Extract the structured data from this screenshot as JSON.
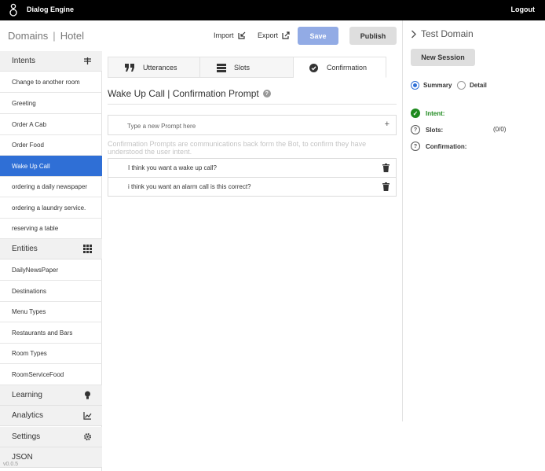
{
  "app": {
    "title": "Dialog Engine",
    "logout_label": "Logout",
    "version": "v0.0.5"
  },
  "breadcrumb": {
    "domains": "Domains",
    "separator": "|",
    "current": "Hotel"
  },
  "header": {
    "import_label": "Import",
    "export_label": "Export",
    "save_label": "Save",
    "publish_label": "Publish"
  },
  "sidebar": {
    "intents_label": "Intents",
    "intents": [
      {
        "label": "Change to another room"
      },
      {
        "label": "Greeting"
      },
      {
        "label": "Order A Cab"
      },
      {
        "label": "Order Food"
      },
      {
        "label": "Wake Up Call",
        "active": true
      },
      {
        "label": "ordering a daily newspaper"
      },
      {
        "label": "ordering a laundry service."
      },
      {
        "label": "reserving a table"
      }
    ],
    "entities_label": "Entities",
    "entities": [
      {
        "label": "DailyNewsPaper"
      },
      {
        "label": "Destinations"
      },
      {
        "label": "Menu Types"
      },
      {
        "label": "Restaurants and Bars"
      },
      {
        "label": "Room Types"
      },
      {
        "label": "RoomServiceFood"
      }
    ],
    "learning_label": "Learning",
    "analytics_label": "Analytics",
    "settings_label": "Settings",
    "json_label": "JSON"
  },
  "tabs": [
    {
      "label": "Utterances",
      "icon": "quote-icon"
    },
    {
      "label": "Slots",
      "icon": "list-icon"
    },
    {
      "label": "Confirmation",
      "icon": "check-circle-icon",
      "active": true
    }
  ],
  "main": {
    "title": "Wake Up Call | Confirmation Prompt",
    "help": "?",
    "input_placeholder": "Type a new Prompt here",
    "add_symbol": "+",
    "description": "Confirmation Prompts are communications back form the Bot, to confirm they have understood the user intent.",
    "prompts": [
      {
        "text": "I think you want a wake up call?"
      },
      {
        "text": "i think you want an alarm call is this correct?"
      }
    ]
  },
  "test_panel": {
    "title": "Test Domain",
    "new_session_label": "New Session",
    "summary_label": "Summary",
    "detail_label": "Detail",
    "selected_view": "Summary",
    "intent_label": "Intent:",
    "slots_label": "Slots:",
    "slots_count": "(0/0)",
    "confirmation_label": "Confirmation:"
  },
  "colors": {
    "accent": "#2f6fd6",
    "save_button": "#92abe5",
    "success": "#1e8a1e",
    "topbar": "#000000"
  }
}
